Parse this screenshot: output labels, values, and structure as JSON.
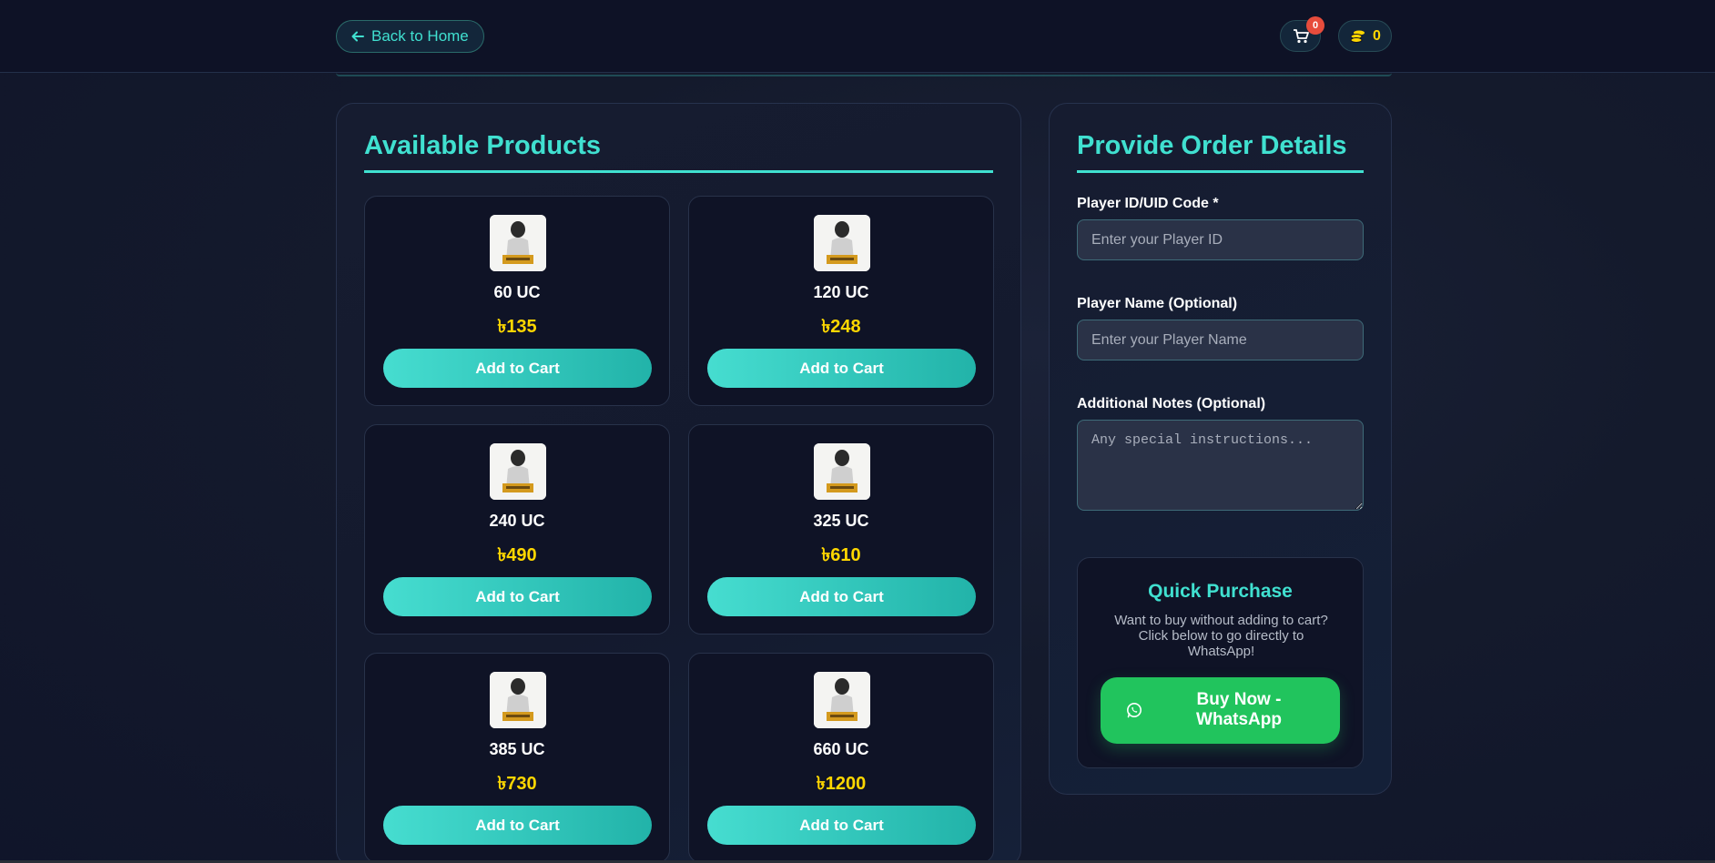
{
  "header": {
    "back_label": "Back to Home",
    "cart_count": "0",
    "coins": "0"
  },
  "products_panel": {
    "title": "Available Products",
    "items": [
      {
        "name": "60 UC",
        "price": "৳135",
        "button": "Add to Cart"
      },
      {
        "name": "120 UC",
        "price": "৳248",
        "button": "Add to Cart"
      },
      {
        "name": "240 UC",
        "price": "৳490",
        "button": "Add to Cart"
      },
      {
        "name": "325 UC",
        "price": "৳610",
        "button": "Add to Cart"
      },
      {
        "name": "385 UC",
        "price": "৳730",
        "button": "Add to Cart"
      },
      {
        "name": "660 UC",
        "price": "৳1200",
        "button": "Add to Cart"
      }
    ]
  },
  "order_panel": {
    "title": "Provide Order Details",
    "player_id_label": "Player ID/UID Code *",
    "player_id_placeholder": "Enter your Player ID",
    "player_name_label": "Player Name (Optional)",
    "player_name_placeholder": "Enter your Player Name",
    "notes_label": "Additional Notes (Optional)",
    "notes_placeholder": "Any special instructions...",
    "quick_purchase": {
      "title": "Quick Purchase",
      "description": "Want to buy without adding to cart? Click below to go directly to WhatsApp!",
      "button": "Buy Now - WhatsApp"
    }
  },
  "colors": {
    "accent": "#40e0d0",
    "price": "#ffd700",
    "whatsapp": "#21c45d",
    "badge": "#e74c3c"
  }
}
